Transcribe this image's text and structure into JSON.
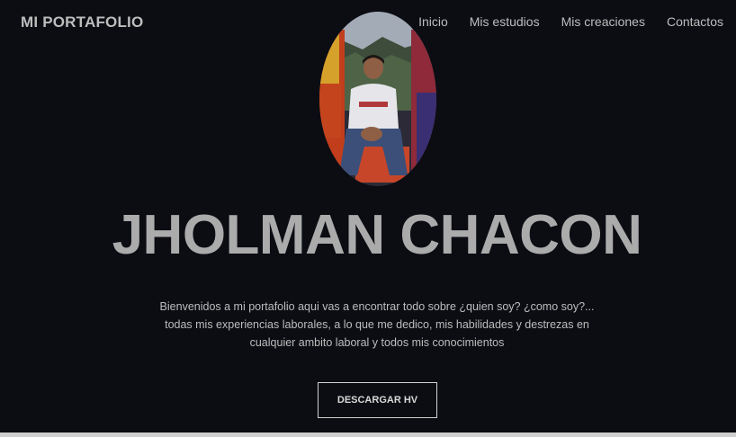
{
  "header": {
    "brand": "MI PORTAFOLIO",
    "nav": [
      {
        "label": "Inicio"
      },
      {
        "label": "Mis estudios"
      },
      {
        "label": "Mis creaciones"
      },
      {
        "label": "Contactos"
      }
    ]
  },
  "hero": {
    "name": "JHOLMAN CHACON",
    "intro": "Bienvenidos a mi portafolio aqui vas a encontrar todo sobre ¿quien soy? ¿como soy?... todas mis experiencias laborales, a lo que me dedico, mis habilidades y destrezas en cualquier ambito laboral y todos mis conocimientos",
    "button_label": "DESCARGAR HV"
  },
  "colors": {
    "background": "#0b0d13",
    "text": "#bdbdbd",
    "name": "#ababab"
  }
}
